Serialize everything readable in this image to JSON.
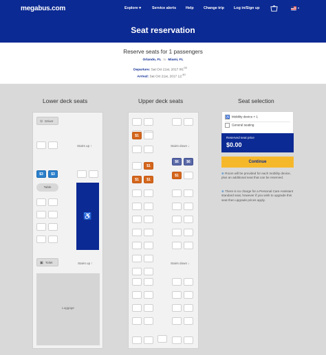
{
  "nav": {
    "logo": "megabus.com",
    "items": [
      "Explore",
      "Service alerts",
      "Help",
      "Change trip",
      "Log in/Sign up"
    ],
    "explore_caret": "▾",
    "cart_icon": "basket-icon",
    "flag_caret": "▾"
  },
  "hero": {
    "title": "Seat reservation"
  },
  "trip": {
    "title": "Reserve seats for 1 passengers",
    "origin": "Orlando, FL",
    "to": "to",
    "destination": "Miami, FL",
    "departure_label": "Departure:",
    "departure_value": "Sat Oct 21st, 2017 06:",
    "departure_sup": "00",
    "arrival_label": "Arrival:",
    "arrival_value": "Sat Oct 21st, 2017 12:",
    "arrival_sup": "40"
  },
  "lower": {
    "title": "Lower deck seats",
    "driver": "Driver",
    "stairs_up_1": "Stairs up",
    "stairs_up_2": "Stairs up",
    "table": "Table",
    "toilet": "Toilet",
    "luggage": "Luggage",
    "wheelchair_icon": "wheelchair-icon",
    "seat_prices": {
      "a": "$3",
      "b": "$3"
    }
  },
  "upper": {
    "title": "Upper deck seats",
    "stairs_down_1": "Stairs down",
    "stairs_down_2": "Stairs down",
    "prices": {
      "p1": "$1",
      "p2": "$1",
      "p3": "$1",
      "p4": "$1",
      "p5": "$1",
      "p6": "$6",
      "p7": "$6",
      "p8": "$1"
    }
  },
  "selection": {
    "title": "Seat selection",
    "mobility": "Mobility device × 1",
    "general": "General seating",
    "price_label": "Reserved seat price",
    "price_value": "$0.00",
    "continue": "Continue",
    "note1": "Room will be provided for each mobility device, plus an additional seat that can be reserved.",
    "note2": "There is no charge for a Personal Care Assistant standard seat, however if you wish to upgrade this seat then upgrade prices apply."
  },
  "colors": {
    "brand_navy": "#0c2a93",
    "orange_seat": "#d4661c",
    "blue_seat": "#2a7fcb",
    "accent_yellow": "#f6b82b"
  }
}
